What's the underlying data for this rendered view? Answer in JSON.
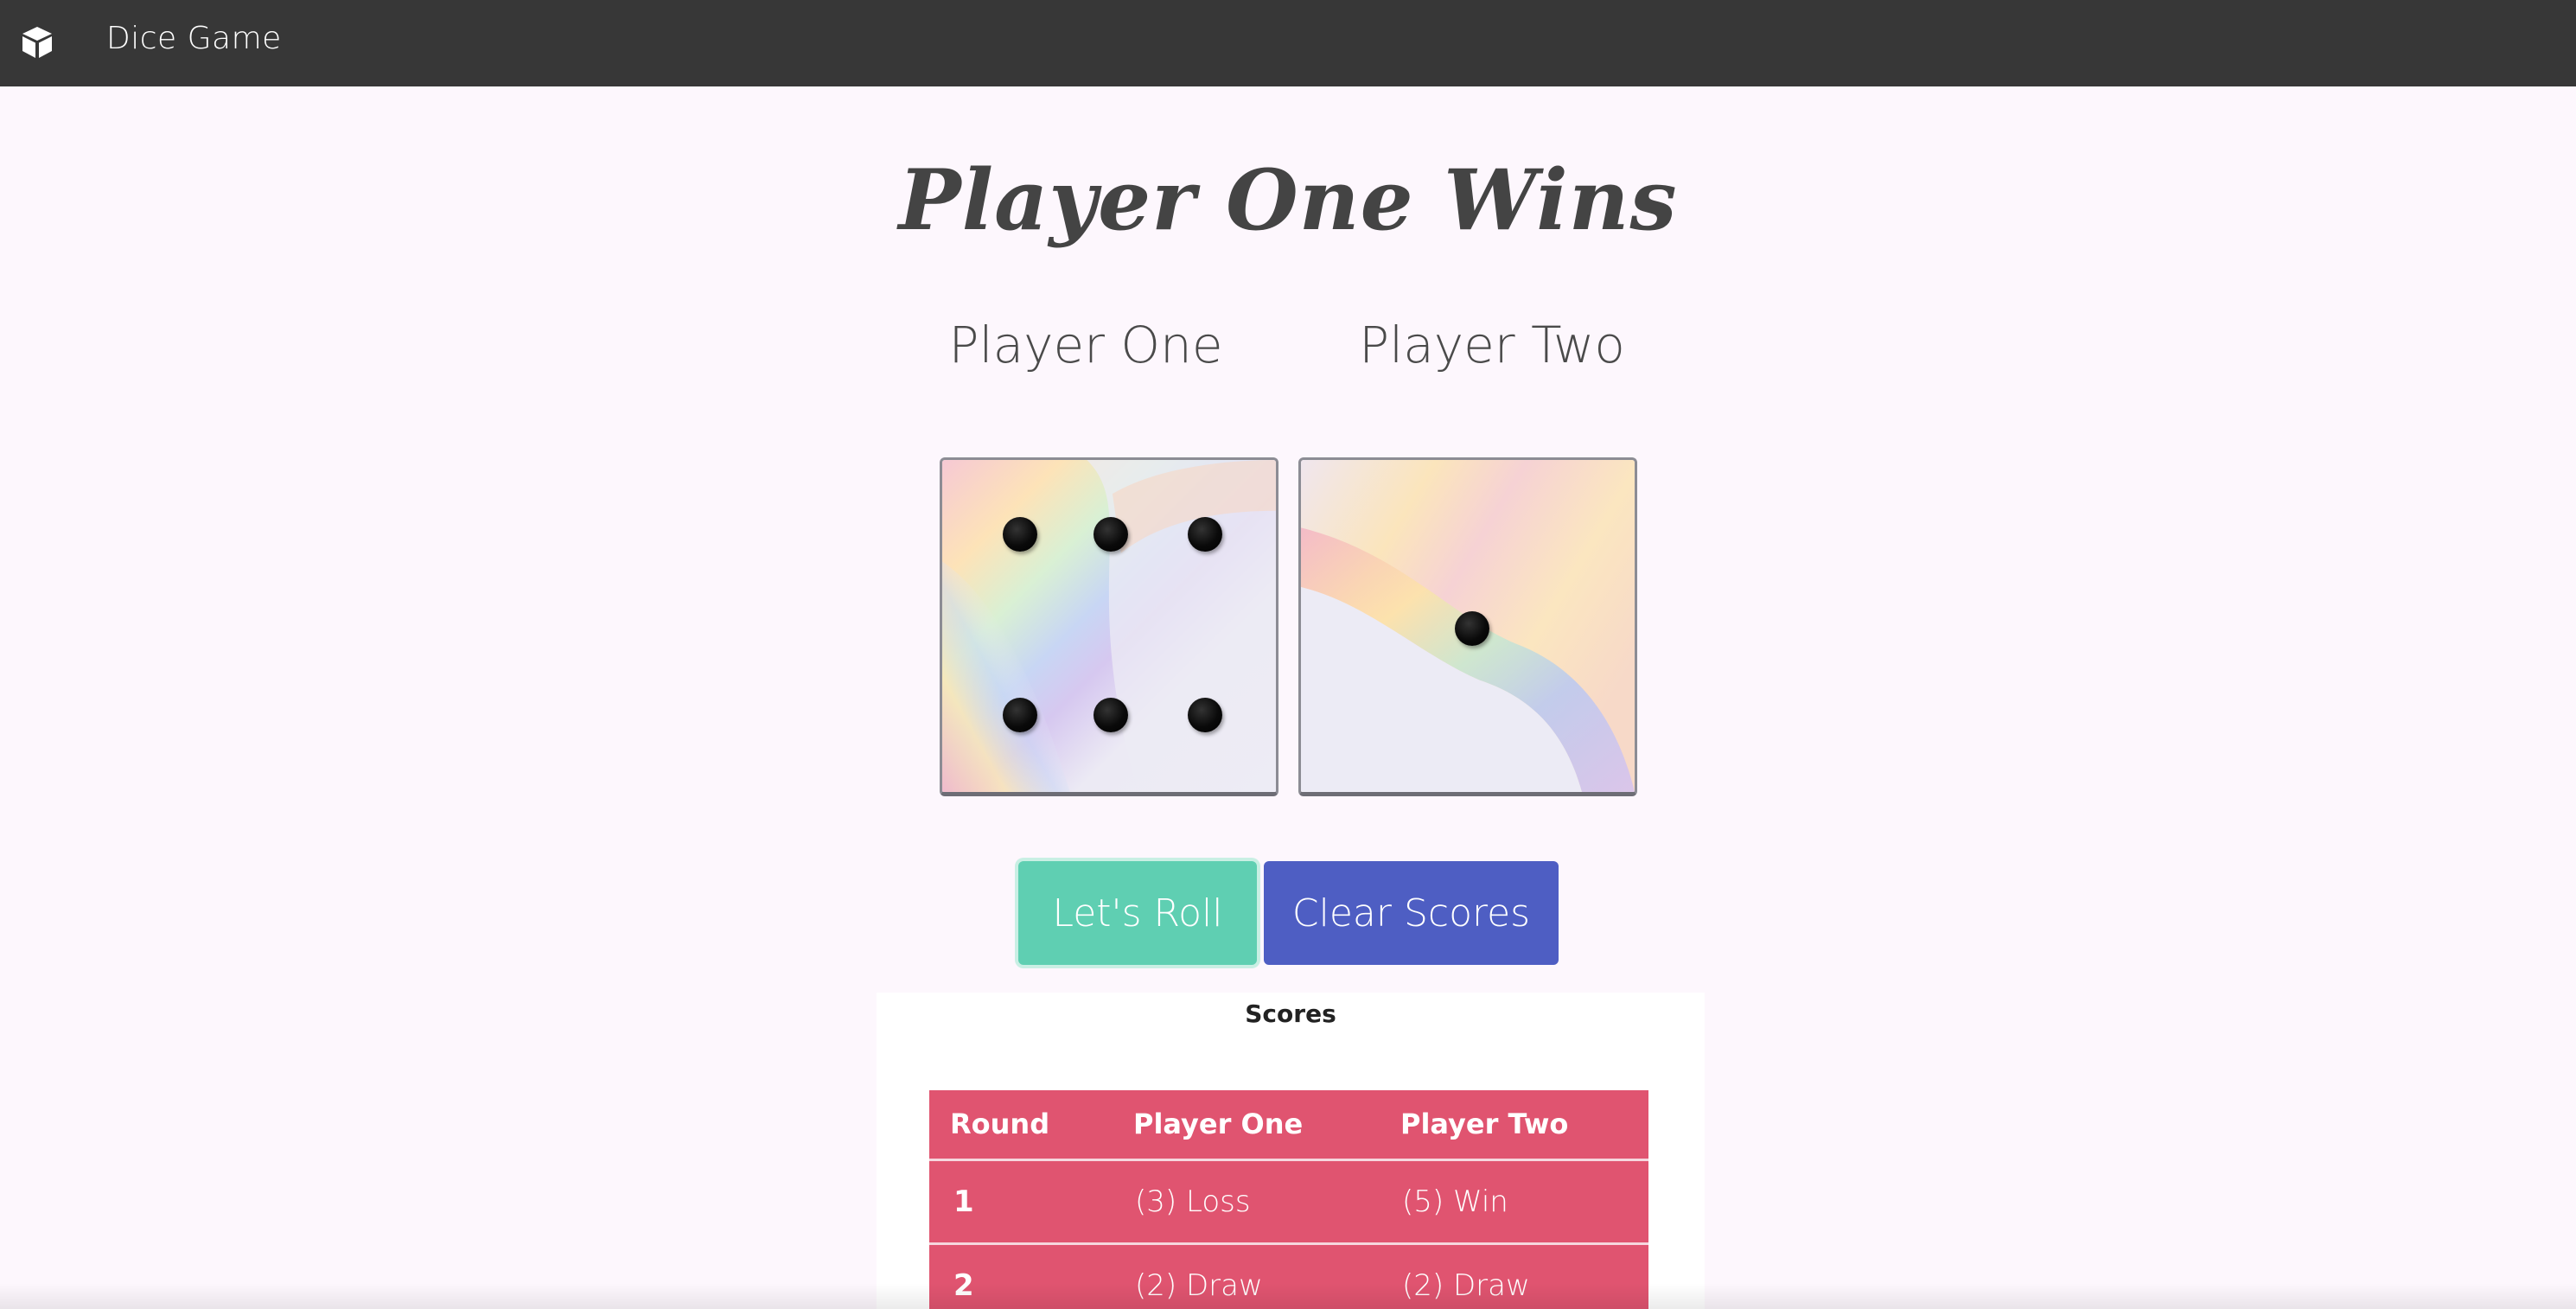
{
  "navbar": {
    "icon": "cube-icon",
    "title": "Dice Game",
    "background": "#373737"
  },
  "result": {
    "title": "Player One Wins"
  },
  "players": {
    "one": "Player One",
    "two": "Player Two"
  },
  "dice": {
    "left_value": 6,
    "right_value": 1
  },
  "buttons": {
    "roll_label": "Let's Roll",
    "clear_label": "Clear Scores",
    "roll_color": "#5fcfb2",
    "clear_color": "#4e5ec3"
  },
  "scores": {
    "title": "Scores",
    "headers": [
      "Round",
      "Player One",
      "Player Two"
    ],
    "rows": [
      {
        "round": "1",
        "p1": "(3) Loss",
        "p2": "(5) Win"
      },
      {
        "round": "2",
        "p1": "(2) Draw",
        "p2": "(2) Draw"
      }
    ],
    "table_color": "#e05470"
  }
}
